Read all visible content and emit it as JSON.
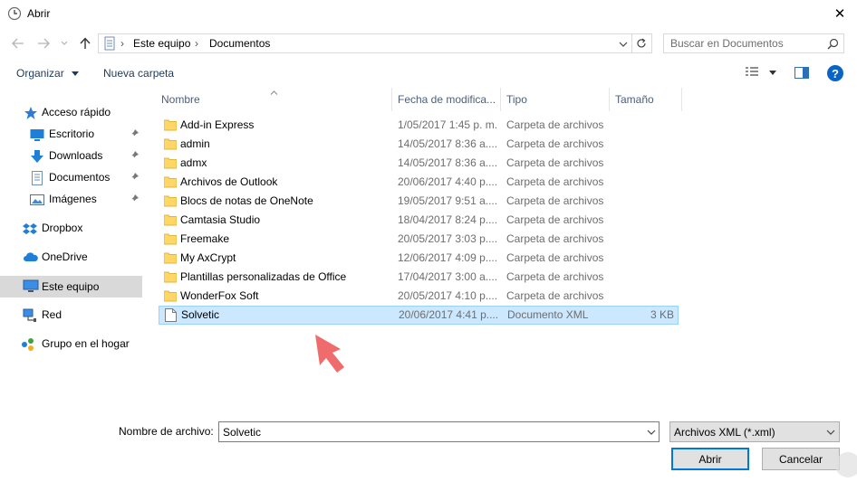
{
  "window": {
    "title": "Abrir",
    "close_glyph": "✕"
  },
  "address": {
    "crumbs": [
      "Este equipo",
      "Documentos"
    ]
  },
  "search": {
    "placeholder": "Buscar en Documentos"
  },
  "toolbar": {
    "organize_label": "Organizar",
    "new_folder_label": "Nueva carpeta",
    "help_glyph": "?"
  },
  "sidebar": {
    "items": [
      {
        "label": "Acceso rápido",
        "icon": "star-icon"
      },
      {
        "label": "Escritorio",
        "icon": "desktop-icon",
        "pinned": true
      },
      {
        "label": "Downloads",
        "icon": "download-icon",
        "pinned": true
      },
      {
        "label": "Documentos",
        "icon": "document-icon",
        "pinned": true
      },
      {
        "label": "Imágenes",
        "icon": "pictures-icon",
        "pinned": true
      },
      {
        "label": "Dropbox",
        "icon": "dropbox-icon"
      },
      {
        "label": "OneDrive",
        "icon": "cloud-icon"
      },
      {
        "label": "Este equipo",
        "icon": "computer-icon",
        "selected": true
      },
      {
        "label": "Red",
        "icon": "network-icon"
      },
      {
        "label": "Grupo en el hogar",
        "icon": "homegroup-icon"
      }
    ]
  },
  "columns": {
    "name": "Nombre",
    "date": "Fecha de modifica...",
    "type": "Tipo",
    "size": "Tamaño"
  },
  "files": [
    {
      "name": "Add-in Express",
      "date": "1/05/2017 1:45 p. m.",
      "type": "Carpeta de archivos",
      "size": ""
    },
    {
      "name": "admin",
      "date": "14/05/2017 8:36 a....",
      "type": "Carpeta de archivos",
      "size": ""
    },
    {
      "name": "admx",
      "date": "14/05/2017 8:36 a....",
      "type": "Carpeta de archivos",
      "size": ""
    },
    {
      "name": "Archivos de Outlook",
      "date": "20/06/2017 4:40 p....",
      "type": "Carpeta de archivos",
      "size": ""
    },
    {
      "name": "Blocs de notas de OneNote",
      "date": "19/05/2017 9:51 a....",
      "type": "Carpeta de archivos",
      "size": ""
    },
    {
      "name": "Camtasia Studio",
      "date": "18/04/2017 8:24 p....",
      "type": "Carpeta de archivos",
      "size": ""
    },
    {
      "name": "Freemake",
      "date": "20/05/2017 3:03 p....",
      "type": "Carpeta de archivos",
      "size": ""
    },
    {
      "name": "My AxCrypt",
      "date": "12/06/2017 4:09 p....",
      "type": "Carpeta de archivos",
      "size": ""
    },
    {
      "name": "Plantillas personalizadas de Office",
      "date": "17/04/2017 3:00 a....",
      "type": "Carpeta de archivos",
      "size": ""
    },
    {
      "name": "WonderFox Soft",
      "date": "20/05/2017 4:10 p....",
      "type": "Carpeta de archivos",
      "size": ""
    },
    {
      "name": "Solvetic",
      "date": "20/06/2017 4:41 p....",
      "type": "Documento XML",
      "size": "3 KB",
      "selected": true
    }
  ],
  "bottom": {
    "filename_label": "Nombre de archivo:",
    "filename_value": "Solvetic",
    "filetype_value": "Archivos XML (*.xml)",
    "open_label": "Abrir",
    "cancel_label": "Cancelar"
  },
  "colors": {
    "accent": "#0078d7",
    "selection": "#cce8ff",
    "folder": "#ffd766",
    "arrow": "#f06b6b"
  }
}
